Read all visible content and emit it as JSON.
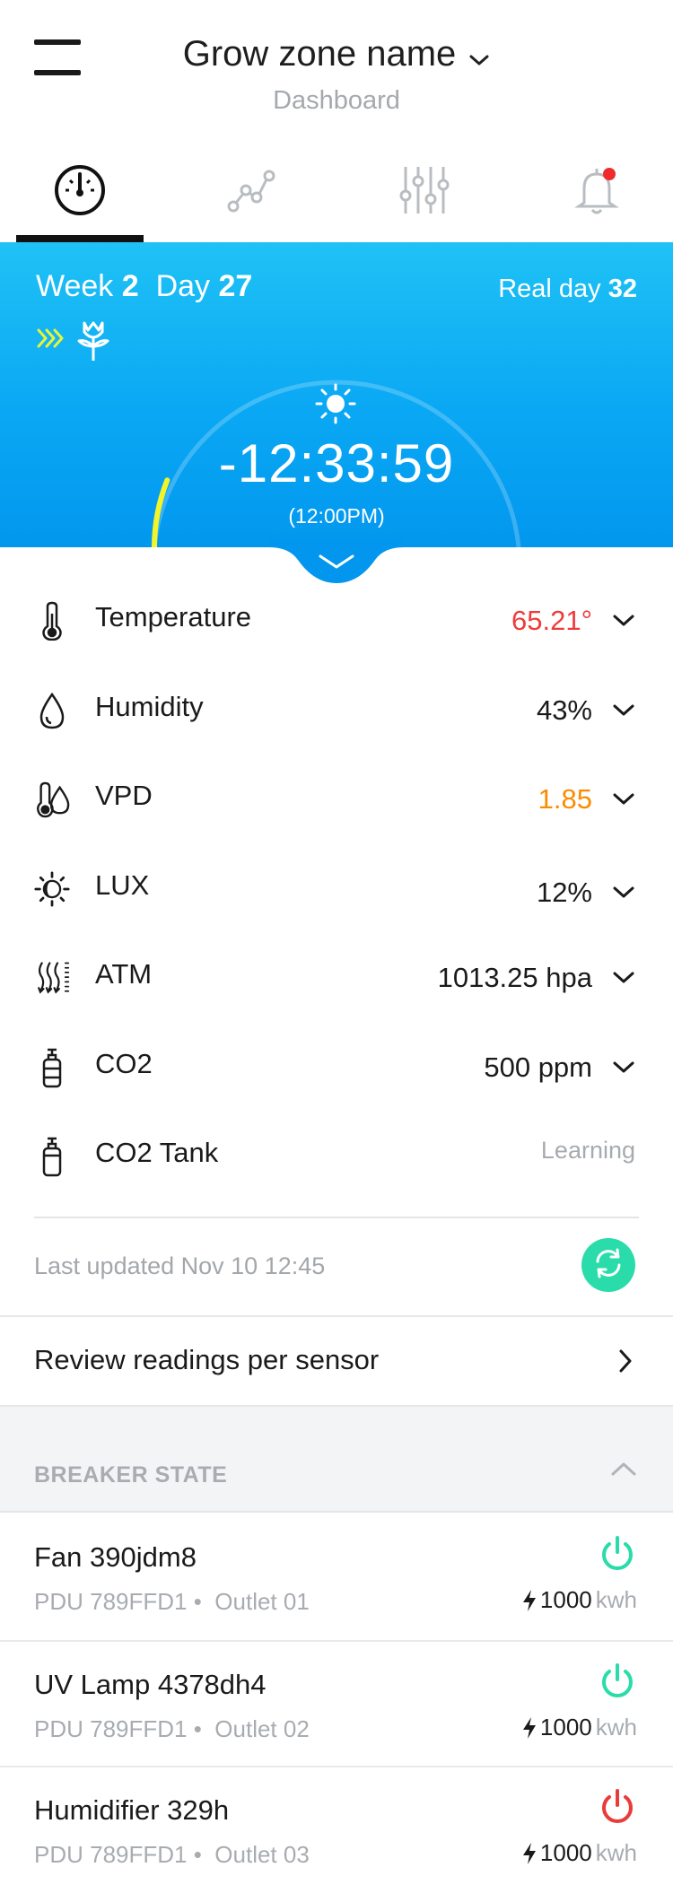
{
  "header": {
    "title": "Grow zone name",
    "subtitle": "Dashboard"
  },
  "tabs": [
    {
      "id": "dashboard",
      "icon": "gauge-icon",
      "active": true
    },
    {
      "id": "graphs",
      "icon": "line-graph-icon",
      "active": false
    },
    {
      "id": "controls",
      "icon": "sliders-icon",
      "active": false
    },
    {
      "id": "alerts",
      "icon": "bell-icon",
      "active": false,
      "has_notification": true
    }
  ],
  "hero": {
    "week_label": "Week",
    "week": "2",
    "day_label": "Day",
    "day": "27",
    "real_day_label": "Real day",
    "real_day": "32",
    "countdown": "-12:33:59",
    "clock": "(12:00PM)",
    "progress_fraction": 0.12,
    "colors": {
      "progress": "#f2f52a",
      "stage_icon": "#e6f53b"
    }
  },
  "readings": [
    {
      "label": "Temperature",
      "value": "65.21°",
      "status": "alert",
      "icon": "thermometer-icon"
    },
    {
      "label": "Humidity",
      "value": "43%",
      "status": "normal",
      "icon": "droplet-icon"
    },
    {
      "label": "VPD",
      "value": "1.85",
      "status": "warning",
      "icon": "vpd-icon"
    },
    {
      "label": "LUX",
      "value": "12%",
      "status": "normal",
      "icon": "sun-moon-icon"
    },
    {
      "label": "ATM",
      "value": "1013.25 hpa",
      "status": "normal",
      "icon": "pressure-icon"
    },
    {
      "label": "CO2",
      "value": "500 ppm",
      "status": "normal",
      "icon": "co2-icon"
    },
    {
      "label": "CO2 Tank",
      "value": "Learning",
      "status": "muted",
      "icon": "tank-icon"
    }
  ],
  "status_colors": {
    "alert": "#ef3b3b",
    "warning": "#fb8c00",
    "on": "#29dcaa",
    "off": "#ea3a3a"
  },
  "last_updated": "Last updated Nov 10 12:45",
  "review_label": "Review readings per sensor",
  "breaker_section_title": "BREAKER STATE",
  "breakers": [
    {
      "name": "Fan 390jdm8",
      "pdu": "PDU 789FFD1",
      "outlet": "Outlet 01",
      "energy": "1000",
      "unit": "kwh",
      "state": "on"
    },
    {
      "name": "UV Lamp 4378dh4",
      "pdu": "PDU 789FFD1",
      "outlet": "Outlet 02",
      "energy": "1000",
      "unit": "kwh",
      "state": "on"
    },
    {
      "name": "Humidifier 329h",
      "pdu": "PDU 789FFD1",
      "outlet": "Outlet 03",
      "energy": "1000",
      "unit": "kwh",
      "state": "off"
    }
  ]
}
